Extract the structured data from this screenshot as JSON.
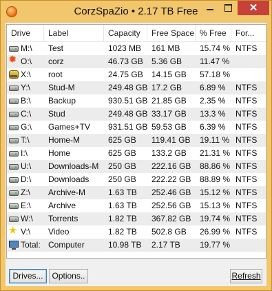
{
  "window": {
    "title": "CorzSpaZio  •  2.17 TB Free",
    "close_glyph": "✕"
  },
  "table": {
    "columns": [
      "Drive",
      "Label",
      "Capacity",
      "Free Space",
      "% Free",
      "For..."
    ],
    "sorted_column": "Free Space",
    "sort_glyph": "^",
    "rows": [
      {
        "drive": "M:\\",
        "label": "Test",
        "capacity": "1023 MB",
        "free": "161 MB",
        "pct": "15.74 %",
        "fs": "NTFS",
        "icon": "hdd-icon"
      },
      {
        "drive": "O:\\",
        "label": "corz",
        "capacity": "46.73 GB",
        "free": "5.36 GB",
        "pct": "11.47 %",
        "fs": "",
        "icon": "network-burst-icon"
      },
      {
        "drive": "X:\\",
        "label": "root",
        "capacity": "24.75 GB",
        "free": "14.15 GB",
        "pct": "57.18 %",
        "fs": "",
        "icon": "root-drive-icon"
      },
      {
        "drive": "Y:\\",
        "label": "Stud-M",
        "capacity": "249.48 GB",
        "free": "17.2 GB",
        "pct": "6.89 %",
        "fs": "NTFS",
        "icon": "hdd-icon"
      },
      {
        "drive": "B:\\",
        "label": "Backup",
        "capacity": "930.51 GB",
        "free": "21.85 GB",
        "pct": "2.35 %",
        "fs": "NTFS",
        "icon": "hdd-icon"
      },
      {
        "drive": "C:\\",
        "label": "Stud",
        "capacity": "249.48 GB",
        "free": "33.17 GB",
        "pct": "13.3 %",
        "fs": "NTFS",
        "icon": "hdd-icon"
      },
      {
        "drive": "G:\\",
        "label": "Games+TV",
        "capacity": "931.51 GB",
        "free": "59.53 GB",
        "pct": "6.39 %",
        "fs": "NTFS",
        "icon": "hdd-icon"
      },
      {
        "drive": "T:\\",
        "label": "Home-M",
        "capacity": "625 GB",
        "free": "119.41 GB",
        "pct": "19.11 %",
        "fs": "NTFS",
        "icon": "hdd-icon"
      },
      {
        "drive": "I:\\",
        "label": "Home",
        "capacity": "625 GB",
        "free": "133.2 GB",
        "pct": "21.31 %",
        "fs": "NTFS",
        "icon": "hdd-icon"
      },
      {
        "drive": "U:\\",
        "label": "Downloads-M",
        "capacity": "250 GB",
        "free": "222.16 GB",
        "pct": "88.86 %",
        "fs": "NTFS",
        "icon": "hdd-icon"
      },
      {
        "drive": "D:\\",
        "label": "Downloads",
        "capacity": "250 GB",
        "free": "222.22 GB",
        "pct": "88.89 %",
        "fs": "NTFS",
        "icon": "hdd-icon"
      },
      {
        "drive": "Z:\\",
        "label": "Archive-M",
        "capacity": "1.63 TB",
        "free": "252.46 GB",
        "pct": "15.12 %",
        "fs": "NTFS",
        "icon": "hdd-icon"
      },
      {
        "drive": "E:\\",
        "label": "Archive",
        "capacity": "1.63 TB",
        "free": "252.56 GB",
        "pct": "15.13 %",
        "fs": "NTFS",
        "icon": "hdd-icon"
      },
      {
        "drive": "W:\\",
        "label": "Torrents",
        "capacity": "1.82 TB",
        "free": "367.82 GB",
        "pct": "19.74 %",
        "fs": "NTFS",
        "icon": "hdd-icon"
      },
      {
        "drive": "V:\\",
        "label": "Video",
        "capacity": "1.82 TB",
        "free": "502.8 GB",
        "pct": "26.99 %",
        "fs": "NTFS",
        "icon": "star-icon"
      },
      {
        "drive": "Total:",
        "label": "Computer",
        "capacity": "10.98 TB",
        "free": "2.17 TB",
        "pct": "19.77 %",
        "fs": "",
        "icon": "computer-icon"
      }
    ]
  },
  "buttons": {
    "drives": "Drives...",
    "options": "Options..",
    "refresh": "Refresh"
  }
}
